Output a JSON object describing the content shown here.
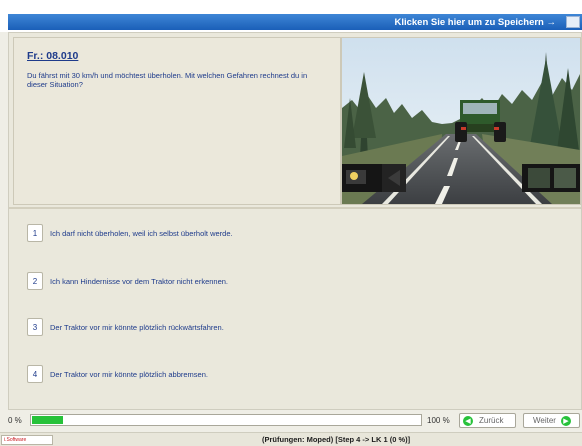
{
  "header": {
    "save_label": "Klicken Sie hier um zu Speichern →"
  },
  "question": {
    "number": "Fr.: 08.010",
    "text": "Du fährst mit 30 km/h und möchtest überholen. Mit welchen Gefahren rechnest du in dieser Situation?"
  },
  "answers": [
    {
      "num": "1",
      "text": "Ich darf nicht überholen, weil ich selbst überholt werde."
    },
    {
      "num": "2",
      "text": "Ich kann Hindernisse vor dem Traktor nicht erkennen."
    },
    {
      "num": "3",
      "text": "Der Traktor vor mir könnte plötzlich rückwärtsfahren."
    },
    {
      "num": "4",
      "text": "Der Traktor vor mir könnte plötzlich abbremsen."
    }
  ],
  "progress": {
    "left_label": "0 %",
    "right_label": "100 %",
    "fraction": 0.08
  },
  "nav": {
    "back_label": "Zurück",
    "next_label": "Weiter"
  },
  "status": {
    "logo_text": "i.Software",
    "text": "(Prüfungen: Moped) [Step 4 -> LK 1 (0 %)]"
  },
  "colors": {
    "accent_blue": "#1b5fb8",
    "text_blue": "#1e3b8b",
    "progress_green": "#27c23a",
    "tractor_green": "#2e5a2b"
  }
}
